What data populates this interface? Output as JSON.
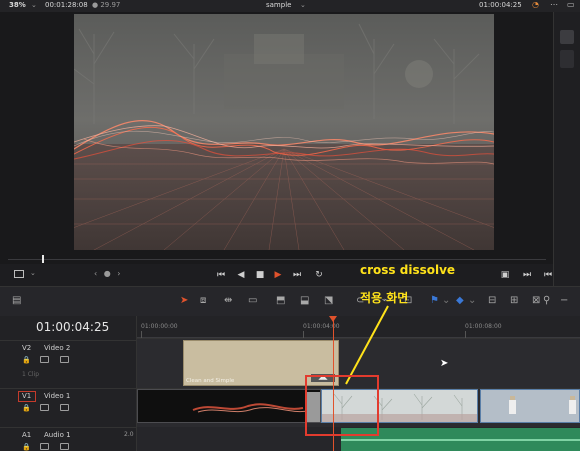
{
  "topbar": {
    "zoom": "38%",
    "timecode_left": "00:01:28:08",
    "fps": "29.97",
    "title": "sample",
    "timecode_right": "01:00:04:25"
  },
  "timeline": {
    "current_timecode": "01:00:04:25",
    "ruler_labels": [
      "01:00:00:00",
      "01:00:04:00",
      "01:00:08:00"
    ],
    "tracks": [
      {
        "id": "V2",
        "name": "Video 2",
        "clips_label": "1 Clip"
      },
      {
        "id": "V1",
        "name": "Video 1",
        "clips_label": ""
      },
      {
        "id": "A1",
        "name": "Audio 1",
        "level": "2.0"
      }
    ],
    "title_clip_caption": "Clean and Simple"
  },
  "annotation": {
    "line1": "cross dissolve",
    "line2": "적용 화면"
  },
  "colors": {
    "accent": "#e0522c",
    "annotation": "#ffe21a",
    "annotation_box": "#e23b2e",
    "audio_clip": "#2f8a5b",
    "clip_selection": "#5a7fa8"
  },
  "icons": {
    "play": "play-icon",
    "stop": "stop-icon",
    "loop": "loop-icon",
    "selection": "arrow-select-icon",
    "blade": "blade-icon",
    "flag": "flag-icon"
  }
}
